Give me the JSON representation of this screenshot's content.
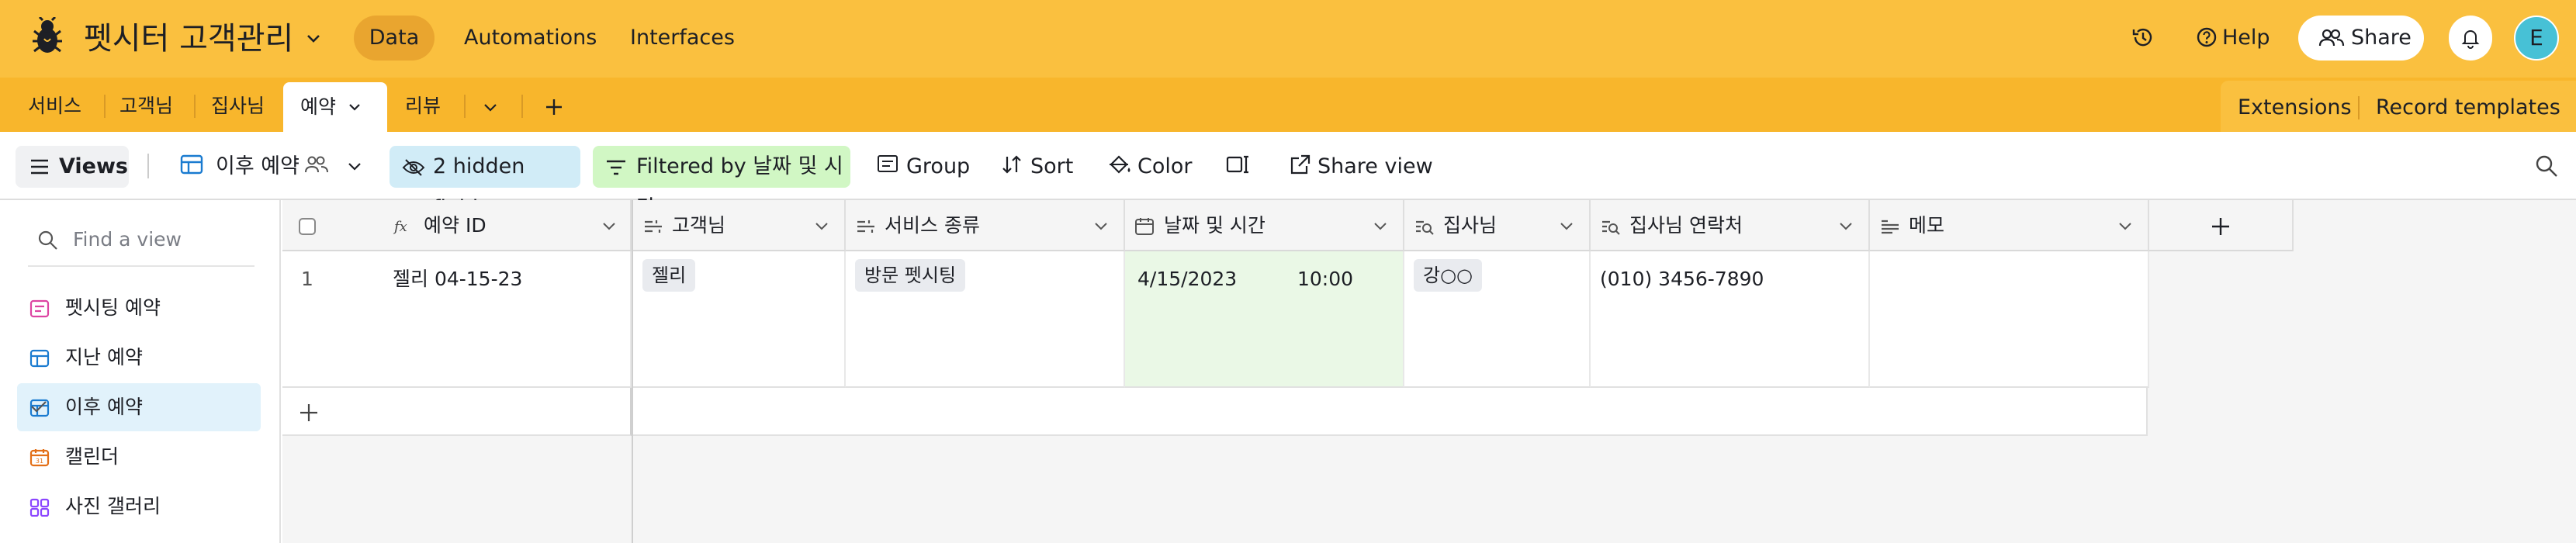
{
  "header": {
    "base_title": "펫시터 고객관리",
    "nav": [
      "Data",
      "Automations",
      "Interfaces"
    ],
    "help_label": "Help",
    "share_label": "Share",
    "avatar_initial": "E",
    "accent_color": "#fac03f"
  },
  "tabs": {
    "items": [
      "서비스",
      "고객님",
      "집사님",
      "예약",
      "리뷰"
    ],
    "active": "예약",
    "extensions_label": "Extensions",
    "record_templates_label": "Record templates"
  },
  "viewbar": {
    "views_label": "Views",
    "current_view": "이후 예약",
    "hidden_fields": "2 hidden fields",
    "filter_label": "Filtered by 날짜 및 시간",
    "group_label": "Group",
    "sort_label": "Sort",
    "color_label": "Color",
    "share_view_label": "Share view"
  },
  "sidebar": {
    "find_placeholder": "Find a view",
    "views": [
      {
        "label": "펫시팅 예약",
        "icon": "form-icon"
      },
      {
        "label": "지난 예약",
        "icon": "grid-icon"
      },
      {
        "label": "이후 예약",
        "icon": "grid-icon",
        "active": true
      },
      {
        "label": "캘린더",
        "icon": "calendar-icon"
      },
      {
        "label": "사진 갤러리",
        "icon": "gallery-icon"
      }
    ]
  },
  "grid": {
    "columns": [
      "예약 ID",
      "고객님",
      "서비스 종류",
      "날짜 및 시간",
      "집사님",
      "집사님 연락처",
      "메모"
    ],
    "rows": [
      {
        "num": "1",
        "예약 ID": "젤리 04-15-23",
        "고객님": "젤리",
        "서비스 종류": "방문 펫시팅",
        "date": "4/15/2023",
        "time": "10:00",
        "집사님": "강○○",
        "집사님 연락처": "(010) 3456-7890",
        "메모": ""
      }
    ]
  }
}
